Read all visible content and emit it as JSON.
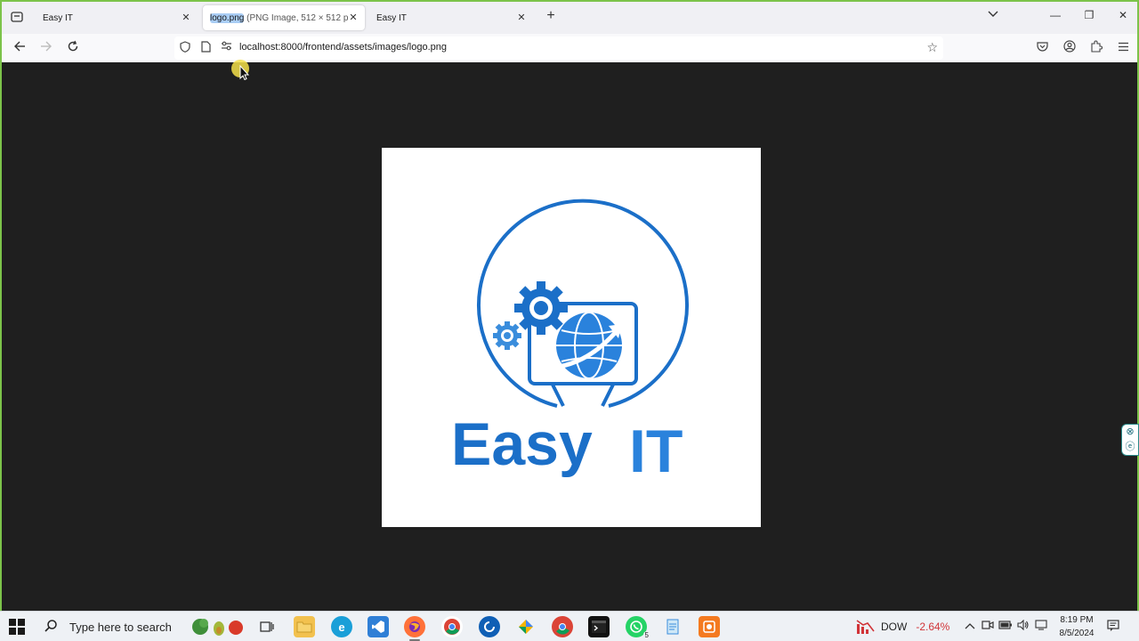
{
  "browser": {
    "tabs": [
      {
        "title": "Easy IT",
        "active": false
      },
      {
        "title_highlight": "logo.png",
        "title_rest": " (PNG Image, 512 × 512 p",
        "active": true
      },
      {
        "title": "Easy IT",
        "active": false
      }
    ],
    "new_tab": "+",
    "url": "localhost:8000/frontend/assets/images/logo.png",
    "icons": {
      "tab_list": "tab-list-icon",
      "back": "back-arrow-icon",
      "forward": "forward-arrow-icon",
      "reload": "reload-icon",
      "shield": "shield-icon",
      "page": "page-icon",
      "permissions": "permissions-icon",
      "bookmark": "star-icon",
      "pocket": "pocket-icon",
      "account": "account-icon",
      "extensions": "extensions-icon",
      "menu": "hamburger-menu-icon"
    }
  },
  "image": {
    "logo_text_primary": "Easy",
    "logo_text_secondary": "IT",
    "brand_color": "#1b6fc8"
  },
  "taskbar": {
    "search_placeholder": "Type here to search",
    "stock_ticker": "DOW",
    "stock_change": "-2.64%",
    "time": "8:19 PM",
    "date": "8/5/2024",
    "whatsapp_badge": "5"
  },
  "colors": {
    "window_border": "#7cc34a",
    "tab_highlight": "#a9cdf5",
    "stock_negative": "#d13438"
  }
}
